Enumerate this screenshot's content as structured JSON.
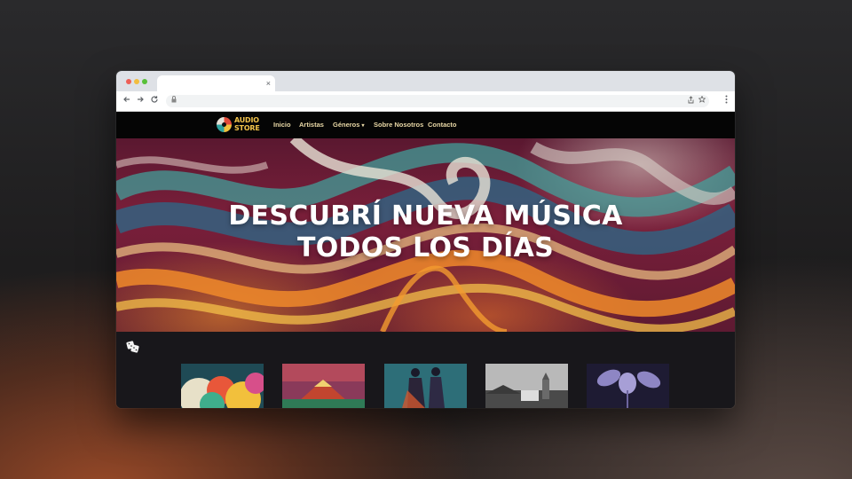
{
  "browser": {
    "tab_close": "×",
    "back_icon": "arrow-left-icon",
    "forward_icon": "arrow-right-icon",
    "reload_icon": "reload-icon"
  },
  "site": {
    "logo_line1": "AUDIO",
    "logo_line2": "STORE",
    "nav": [
      "Inicio",
      "Artistas",
      "Géneros",
      "Sobre Nosotros",
      "Contacto"
    ],
    "dropdown_caret": "▾"
  },
  "hero": {
    "line1": "DESCUBRÍ NUEVA MÚSICA",
    "line2": "TODOS LOS DÍAS"
  },
  "colors": {
    "nav_bg": "#050505",
    "nav_text": "#e9d8a6",
    "logo": "#f1c24a",
    "page_bg": "#18171b"
  },
  "albums": [
    {
      "name": "colorful-clouds"
    },
    {
      "name": "volcano-landscape"
    },
    {
      "name": "dancing-couple"
    },
    {
      "name": "village-church"
    },
    {
      "name": "purple-leaves"
    }
  ]
}
